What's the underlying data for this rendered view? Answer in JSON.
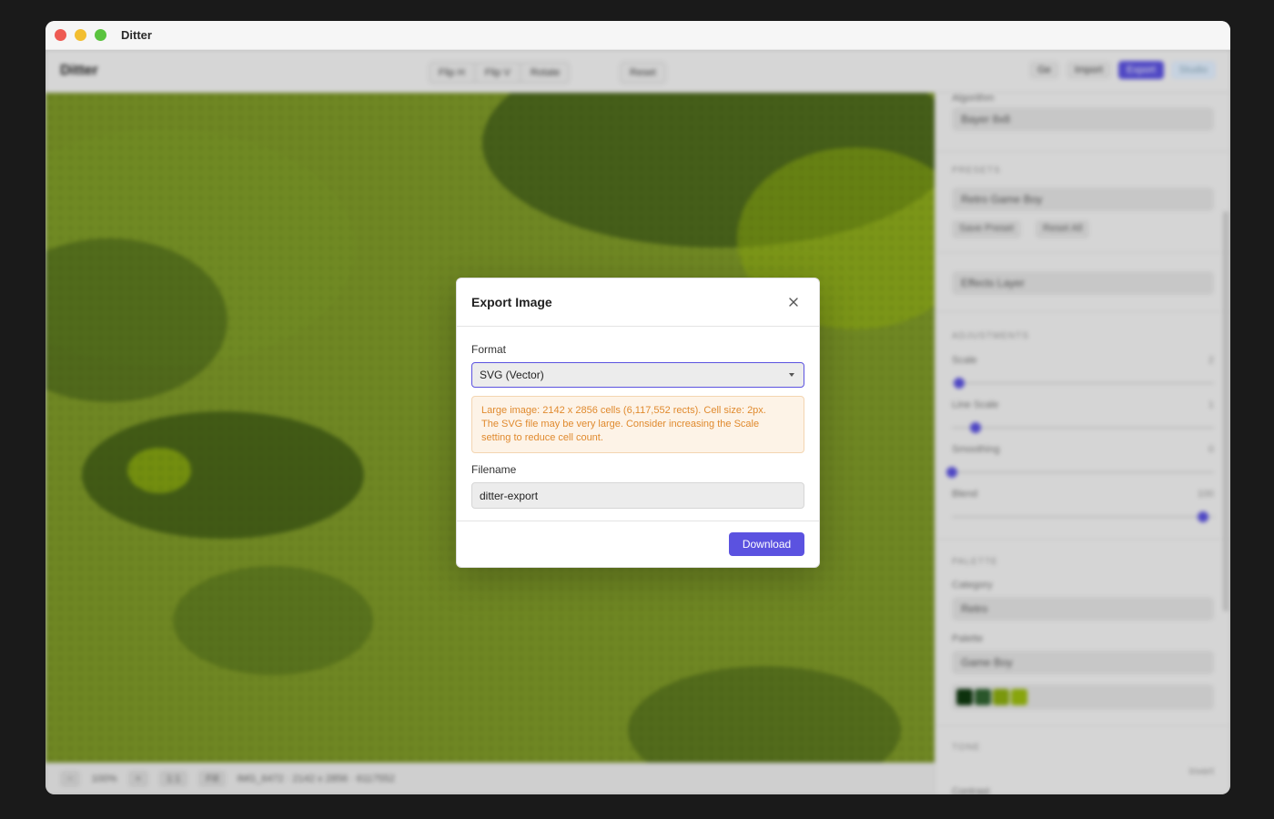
{
  "window": {
    "title": "Ditter"
  },
  "app": {
    "brand": "Ditter",
    "toolbar": {
      "flip_group": [
        "Flip H",
        "Flip V",
        "Rotate"
      ],
      "reset_label": "Reset",
      "right": [
        "Ge",
        "Import",
        "Export",
        "Studio"
      ]
    },
    "statusbar": {
      "zoom": "100%",
      "fit_label": "1:1",
      "fill_label": "Fill",
      "info": "IMG_6472 · 2142 x 2856 · 6117552"
    },
    "sidebar": {
      "algorithm_label": "Algorithm",
      "algorithm_value": "Bayer 8x8",
      "presets_section": "PRESETS",
      "preset_value": "Retro Game Boy",
      "preset_chips": [
        "Save Preset",
        "Reset All"
      ],
      "effects_value": "Effects Layer",
      "adjustments_section": "ADJUSTMENTS",
      "scale_label": "Scale",
      "scale_value": "2",
      "line_scale_label": "Line Scale",
      "line_scale_value": "1",
      "smoothing_label": "Smoothing",
      "smoothing_value": "0",
      "blend_label": "Blend",
      "blend_value": "100",
      "palette_section": "PALETTE",
      "category_label": "Category",
      "category_value": "Retro",
      "palette_label": "Palette",
      "palette_value": "Game Boy",
      "swatch_colors": [
        "#0f380f",
        "#306230",
        "#8bac0f",
        "#9bbc0f"
      ],
      "tone_section": "TONE",
      "invert_label": "Invert",
      "contrast_label": "Contrast"
    }
  },
  "modal": {
    "title": "Export Image",
    "format_label": "Format",
    "format_value": "SVG (Vector)",
    "warning_line1": "Large image: 2142 x 2856 cells (6,117,552 rects). Cell size: 2px.",
    "warning_line2": "The SVG file may be very large. Consider increasing the Scale",
    "warning_line3": "setting to reduce cell count.",
    "filename_label": "Filename",
    "filename_value": "ditter-export",
    "download_label": "Download"
  }
}
